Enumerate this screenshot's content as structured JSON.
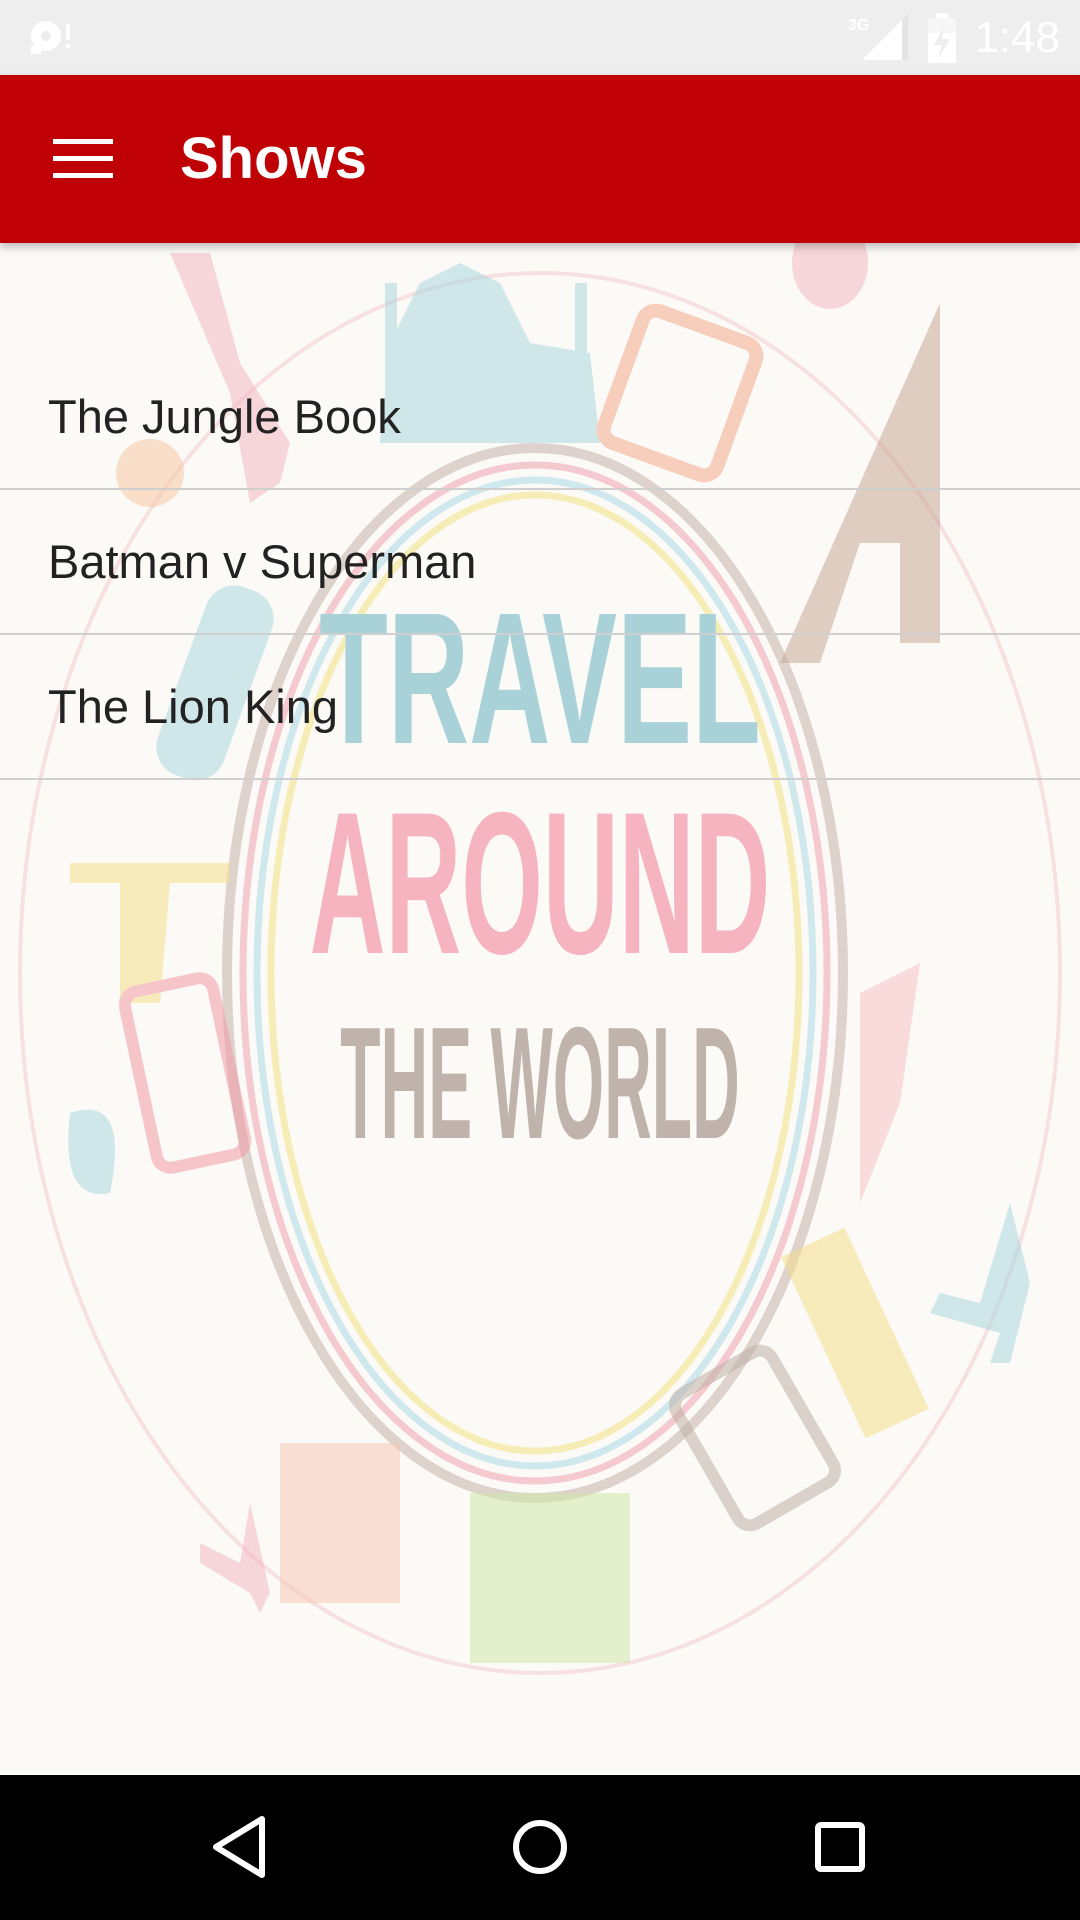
{
  "status_bar": {
    "time": "1:48",
    "network_label": "3G",
    "icons": [
      "notification-icon",
      "signal-icon",
      "battery-icon"
    ]
  },
  "app_bar": {
    "title": "Shows",
    "menu_icon": "hamburger-menu-icon",
    "background_color": "#bf0005"
  },
  "background": {
    "line1": "TRAVEL",
    "line2": "AROUND",
    "line3": "THE WORLD"
  },
  "shows": [
    {
      "title": "The Jungle Book"
    },
    {
      "title": "Batman v Superman"
    },
    {
      "title": "The Lion King"
    }
  ],
  "nav_bar": {
    "icons": [
      "back-icon",
      "home-icon",
      "recents-icon"
    ]
  }
}
